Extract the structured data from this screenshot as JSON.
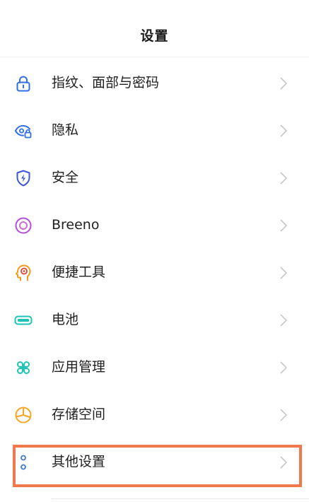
{
  "header": {
    "title": "设置"
  },
  "items": [
    {
      "label": "指纹、面部与密码",
      "icon": "lock-icon",
      "color": "#2e6de6"
    },
    {
      "label": "隐私",
      "icon": "privacy-eye-lock-icon",
      "color": "#2e6de6"
    },
    {
      "label": "安全",
      "icon": "shield-bolt-icon",
      "color": "#3d55d6"
    },
    {
      "label": "Breeno",
      "icon": "breeno-ring-icon",
      "color": "#b44de0"
    },
    {
      "label": "便捷工具",
      "icon": "head-gear-icon",
      "color": "#f29a1f"
    },
    {
      "label": "电池",
      "icon": "battery-icon",
      "color": "#1ec5b4"
    },
    {
      "label": "应用管理",
      "icon": "apps-grid-icon",
      "color": "#1ec5b4"
    },
    {
      "label": "存储空间",
      "icon": "storage-pie-icon",
      "color": "#f5a623"
    },
    {
      "label": "其他设置",
      "icon": "more-dots-icon",
      "color": "#3a7bd5"
    }
  ],
  "highlight_color": "#f2784b"
}
